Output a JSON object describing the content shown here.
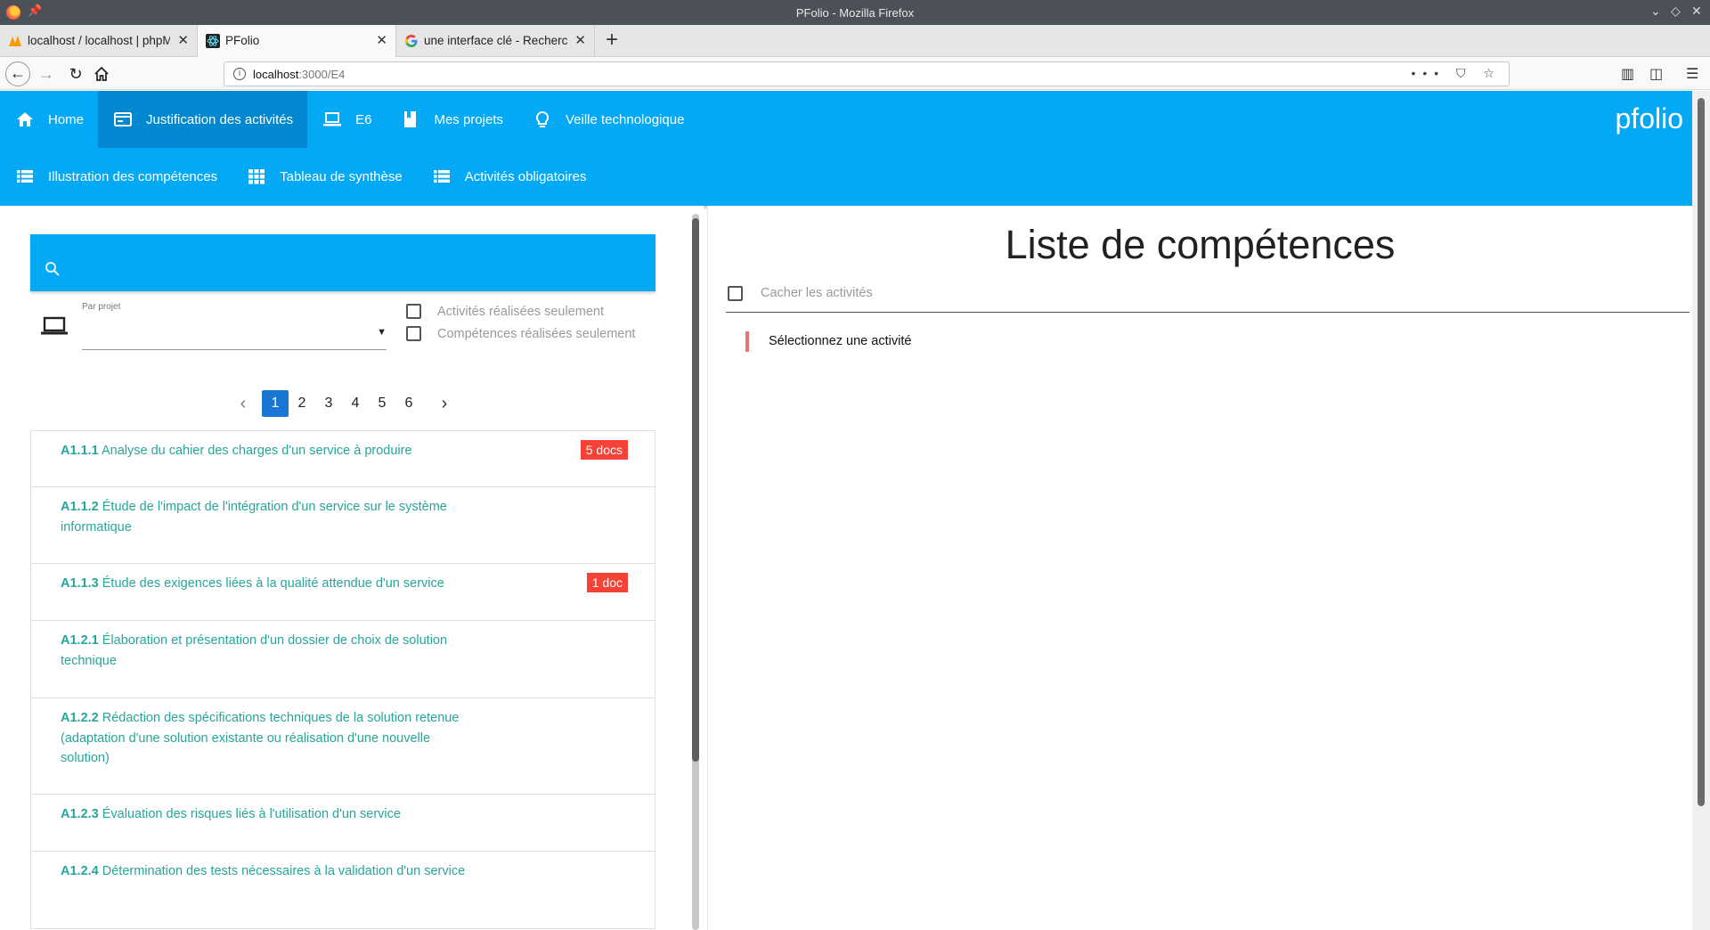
{
  "window": {
    "title": "PFolio - Mozilla Firefox"
  },
  "tabs": [
    {
      "label": "localhost / localhost | phpMyAdmin",
      "close": "✕"
    },
    {
      "label": "PFolio",
      "close": "✕"
    },
    {
      "label": "une interface clé - Recherche Google",
      "close": "✕"
    }
  ],
  "new_tab_symbol": "+",
  "urlbar": {
    "host": "localhost",
    "rest": ":3000/E4",
    "actions": "••• ⛉ ☆"
  },
  "nav_primary": [
    {
      "label": "Home",
      "icon": "home-icon"
    },
    {
      "label": "Justification des activités",
      "icon": "card-icon"
    },
    {
      "label": "E6",
      "icon": "laptop-icon"
    },
    {
      "label": "Mes projets",
      "icon": "book-icon"
    },
    {
      "label": "Veille technologique",
      "icon": "lightbulb-icon"
    }
  ],
  "nav_secondary": [
    {
      "label": "Illustration des compétences",
      "icon": "list-icon"
    },
    {
      "label": "Tableau de synthèse",
      "icon": "grid-icon"
    },
    {
      "label": "Activités obligatoires",
      "icon": "list-icon"
    }
  ],
  "brand": "pfolio",
  "filters": {
    "project_label": "Par projet",
    "dropdown_symbol": "▼",
    "activities_done_only": "Activités réalisées seulement",
    "skills_done_only": "Compétences réalisées seulement"
  },
  "pagination": {
    "prev": "‹",
    "next": "›",
    "pages": [
      "1",
      "2",
      "3",
      "4",
      "5",
      "6"
    ],
    "current": "1"
  },
  "competences": [
    {
      "code": "A1.1.1",
      "text": "Analyse du cahier des charges d'un service à produire",
      "badge": "5 docs"
    },
    {
      "code": "A1.1.2",
      "text": "Étude de l'impact de l'intégration d'un service sur le système informatique",
      "badge": ""
    },
    {
      "code": "A1.1.3",
      "text": "Étude des exigences liées à la qualité attendue d'un service",
      "badge": "1 doc"
    },
    {
      "code": "A1.2.1",
      "text": "Élaboration et présentation d'un dossier de choix de solution technique",
      "badge": ""
    },
    {
      "code": "A1.2.2",
      "text": "Rédaction des spécifications techniques de la solution retenue (adaptation d'une solution existante ou réalisation d'une nouvelle solution)",
      "badge": ""
    },
    {
      "code": "A1.2.3",
      "text": "Évaluation des risques liés à l'utilisation d'un service",
      "badge": ""
    },
    {
      "code": "A1.2.4",
      "text": "Détermination des tests nécessaires à la validation d'un service",
      "badge": ""
    }
  ],
  "right": {
    "title": "Liste de compétences",
    "hide_activities": "Cacher les activités",
    "placeholder": "Sélectionnez une activité"
  },
  "colors": {
    "primary": "#03a9f4",
    "primary_dark": "#0288d1",
    "teal": "#26a69a",
    "badge": "#f44336",
    "page_active": "#1976d2"
  }
}
